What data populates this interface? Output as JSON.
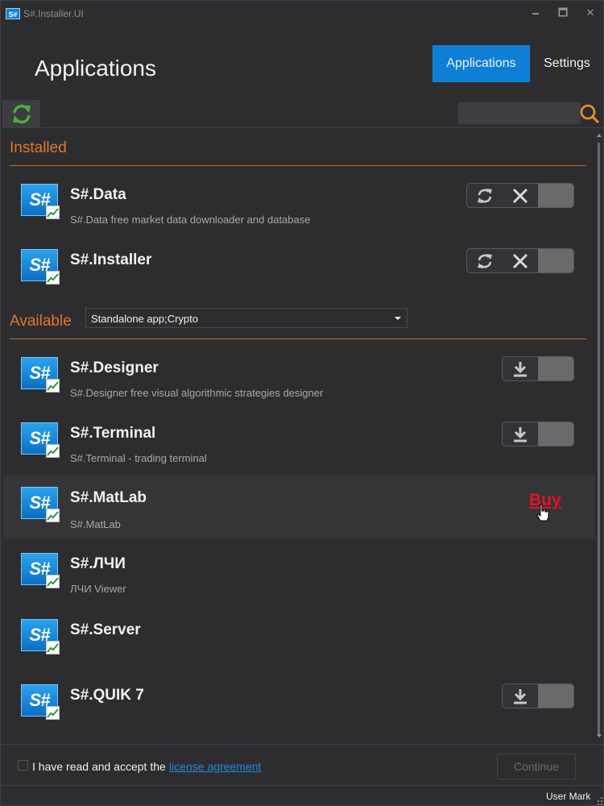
{
  "window": {
    "title": "S#.Installer.UI",
    "icon_text": "S#",
    "minimize": "🗕",
    "maximize": "🗖",
    "close": "✕"
  },
  "header": {
    "title": "Applications",
    "tabs": [
      {
        "label": "Applications",
        "active": true
      },
      {
        "label": "Settings",
        "active": false
      }
    ]
  },
  "toolbar": {
    "refresh_icon": "refresh-icon",
    "search": {
      "value": "",
      "placeholder": ""
    },
    "search_icon": "magnifier-icon"
  },
  "installed": {
    "title": "Installed",
    "apps": [
      {
        "name": "S#.Data",
        "description": "S#.Data free market data downloader and database",
        "actions": [
          "update",
          "remove"
        ]
      },
      {
        "name": "S#.Installer",
        "description": "",
        "actions": [
          "update",
          "remove"
        ]
      }
    ]
  },
  "available": {
    "title": "Available",
    "filter": "Standalone app;Crypto",
    "apps": [
      {
        "name": "S#.Designer",
        "description": "S#.Designer free visual algorithmic strategies designer",
        "action": "download"
      },
      {
        "name": "S#.Terminal",
        "description": "S#.Terminal - trading terminal",
        "action": "download"
      },
      {
        "name": "S#.MatLab",
        "description": "S#.MatLab",
        "action": "buy",
        "buy_label": "Buy"
      },
      {
        "name": "S#.ЛЧИ",
        "description": "ЛЧИ Viewer",
        "action": "none"
      },
      {
        "name": "S#.Server",
        "description": "",
        "action": "none"
      },
      {
        "name": "S#.QUIK 7",
        "description": "",
        "action": "download"
      }
    ]
  },
  "logo_text": "S#",
  "footer": {
    "accept_text": "I have read and accept the",
    "license_link": "license agreement",
    "continue_label": "Continue",
    "accepted": false
  },
  "status": {
    "user": "User Mark"
  },
  "colors": {
    "accent": "#0e7fd6",
    "section": "#e0782a",
    "buy": "#e81123",
    "link": "#1e8ad6",
    "refresh": "#4caf3a"
  }
}
